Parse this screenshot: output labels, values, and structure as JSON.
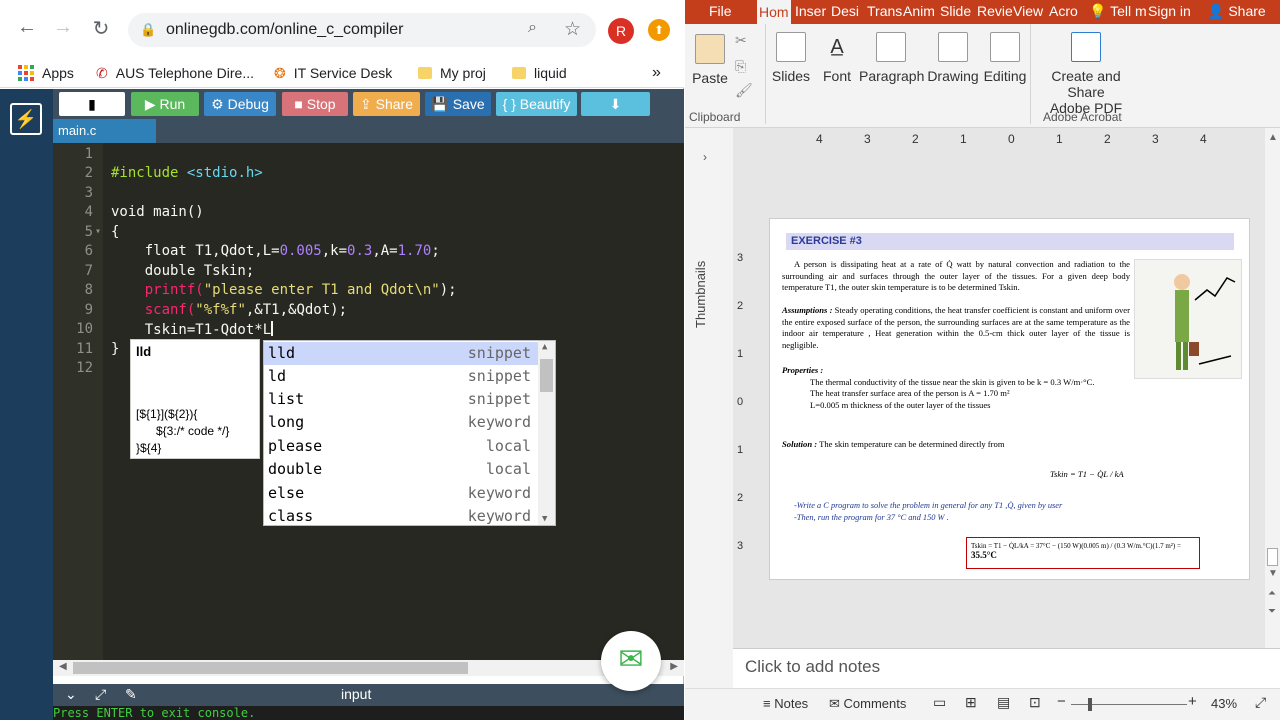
{
  "browser": {
    "url": "onlinegdb.com/online_c_compiler",
    "profile_initial": "R",
    "bookmarks": [
      "Apps",
      "AUS Telephone Dire...",
      "IT Service Desk",
      "My proj",
      "liquid"
    ],
    "more_glyph": "»"
  },
  "gdb": {
    "toolbar": {
      "run": "Run",
      "debug": "Debug",
      "stop": "Stop",
      "share": "Share",
      "save": "Save",
      "beautify": "{ } Beautify"
    },
    "file_tab": "main.c",
    "line_numbers": [
      "1",
      "2",
      "3",
      "4",
      "5",
      "6",
      "7",
      "8",
      "9",
      "10",
      "11",
      "12"
    ],
    "code": {
      "line2_pp": "#include",
      "line2_hdr": " <stdio.h>",
      "line4": "void main()",
      "line5": "{",
      "line6_a": "    float T1,Qdot,L=",
      "line6_n1": "0.005",
      "line6_b": ",k=",
      "line6_n2": "0.3",
      "line6_c": ",A=",
      "line6_n3": "1.70",
      "line6_d": ";",
      "line7": "    double Tskin;",
      "line8_fn": "    printf(",
      "line8_str": "\"please enter T1 and Qdot\\n\"",
      "line8_end": ");",
      "line9_fn": "    scanf(",
      "line9_str": "\"%f%f\"",
      "line9_end": ",&T1,&Qdot);",
      "line10": "    Tskin=T1-Qdot*L",
      "line11": "}"
    },
    "tooltip": {
      "title": "lld",
      "body": "[${1}](${2}){\n      ${3:/* code */}\n}${4}"
    },
    "autocomplete": [
      {
        "word": "lld",
        "type": "snippet"
      },
      {
        "word": "ld",
        "type": "snippet"
      },
      {
        "word": "list",
        "type": "snippet"
      },
      {
        "word": "long",
        "type": "keyword"
      },
      {
        "word": "please",
        "type": "local"
      },
      {
        "word": "double",
        "type": "local"
      },
      {
        "word": "else",
        "type": "keyword"
      },
      {
        "word": "class",
        "type": "keyword"
      }
    ],
    "status_label": "input",
    "console_text": "Press ENTER to exit console."
  },
  "ppt": {
    "tabs": [
      "File",
      "Hom",
      "Inser",
      "Desi",
      "Trans",
      "Anim",
      "Slide",
      "Revie",
      "View",
      "Acro",
      "Tell m",
      "Sign in",
      "Share"
    ],
    "ribbon": {
      "paste": "Paste",
      "clipboard": "Clipboard",
      "slides": "Slides",
      "font": "Font",
      "paragraph": "Paragraph",
      "drawing": "Drawing",
      "editing": "Editing",
      "create_share": "Create and Share",
      "adobe_pdf": "Adobe PDF",
      "adobe_acrobat": "Adobe Acrobat"
    },
    "thumbnails_label": "Thumbnails",
    "ruler_ticks": [
      "4",
      "3",
      "2",
      "1",
      "0",
      "1",
      "2",
      "3",
      "4"
    ],
    "vruler_ticks": [
      "3",
      "2",
      "1",
      "0",
      "1",
      "2",
      "3"
    ],
    "slide": {
      "heading": "EXERCISE #3",
      "p1": "A person is dissipating heat at a rate of Q̇ watt by natural convection and radiation to the surrounding air and surfaces through the outer layer of the tissues. For a given deep body temperature T1, the outer skin temperature is to be determined Tskin.",
      "p2_label": "Assumptions :",
      "p2": "Steady operating conditions, the heat transfer coefficient is constant and uniform over the entire exposed surface of the person, the surrounding surfaces are at the same temperature as the indoor air temperature , Heat generation within the 0.5-cm thick outer layer of the tissue is negligible.",
      "p3_label": "Properties :",
      "p3a": "The thermal conductivity of the tissue near the skin is given to be k = 0.3 W/m·°C.",
      "p3b": "The heat transfer surface area of the person is  A = 1.70 m²",
      "p3c": "L=0.005 m thickness of the outer layer of the tissues",
      "p4_label": "Solution  :",
      "p4": "The skin temperature can be determined directly from",
      "formula": "Tskin = T1 − Q̇L / kA",
      "task1": "-Write a C program to solve the problem in general for any T1 ,Q̇, given by user",
      "task2": "-Then, run the program for 37 °C and 150 W .",
      "result_formula": "Tskin = T1 − Q̇L/kA = 37°C − (150 W)(0.005 m) / (0.3 W/m.°C)(1.7 m²) =",
      "result_value": "35.5°C"
    },
    "notes_placeholder": "Click to add notes",
    "status": {
      "notes": "Notes",
      "comments": "Comments",
      "zoom": "43%"
    }
  }
}
